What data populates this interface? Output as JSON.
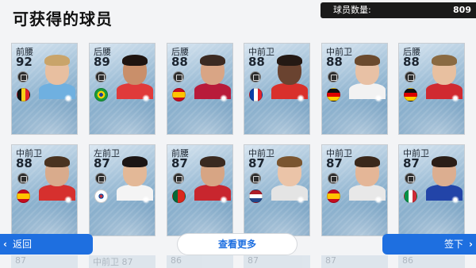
{
  "title": "可获得的球员",
  "count": {
    "label": "球员数量:",
    "value": "809"
  },
  "players": [
    {
      "pos": "前腰",
      "rating": "92",
      "flag": "belgium",
      "skin": "#e8bfa0",
      "hair": "#c9a46a",
      "shirt": "#6fb0e0"
    },
    {
      "pos": "后腰",
      "rating": "89",
      "flag": "brazil",
      "skin": "#c98f6a",
      "hair": "#1e1410",
      "shirt": "#e03a3a"
    },
    {
      "pos": "后腰",
      "rating": "88",
      "flag": "spain",
      "skin": "#d9a585",
      "hair": "#3b2a22",
      "shirt": "#b81b3a"
    },
    {
      "pos": "中前卫",
      "rating": "88",
      "flag": "france",
      "skin": "#6a4330",
      "hair": "#241914",
      "shirt": "#d9302b"
    },
    {
      "pos": "中前卫",
      "rating": "88",
      "flag": "germany",
      "skin": "#e8c1a5",
      "hair": "#6b4a2e",
      "shirt": "#f2f2f2"
    },
    {
      "pos": "后腰",
      "rating": "88",
      "flag": "germany",
      "skin": "#e8c0a0",
      "hair": "#8a6a42",
      "shirt": "#d02a30"
    },
    {
      "pos": "中前卫",
      "rating": "88",
      "flag": "spain",
      "skin": "#d9ab8c",
      "hair": "#4a3320",
      "shirt": "#d6302e"
    },
    {
      "pos": "左前卫",
      "rating": "87",
      "flag": "korea",
      "skin": "#e3b897",
      "hair": "#1b1514",
      "shirt": "#f4f4f4"
    },
    {
      "pos": "前腰",
      "rating": "87",
      "flag": "portugal",
      "skin": "#d7a584",
      "hair": "#3a2a20",
      "shirt": "#c8262e"
    },
    {
      "pos": "中前卫",
      "rating": "87",
      "flag": "netherlands",
      "skin": "#ebc4a8",
      "hair": "#7a5530",
      "shirt": "#e4e4e4"
    },
    {
      "pos": "中前卫",
      "rating": "87",
      "flag": "spain",
      "skin": "#e4b697",
      "hair": "#3a281b",
      "shirt": "#e8e8e8"
    },
    {
      "pos": "中前卫",
      "rating": "87",
      "flag": "italy",
      "skin": "#dcae90",
      "hair": "#2a1e17",
      "shirt": "#2244a8"
    }
  ],
  "ghost_row": [
    "87",
    "中前卫 87",
    "86",
    "87",
    "87",
    "86"
  ],
  "buttons": {
    "back": "返回",
    "more": "查看更多",
    "next": "签下"
  },
  "colors": {
    "accent": "#1e6fe0"
  }
}
